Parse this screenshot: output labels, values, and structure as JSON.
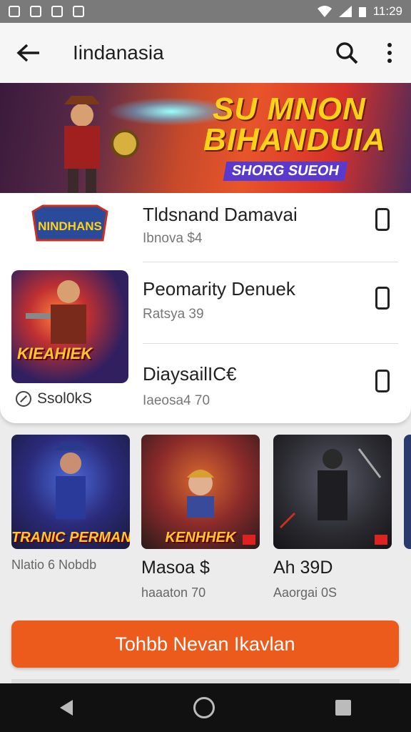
{
  "status_bar": {
    "time": "11:29"
  },
  "app_bar": {
    "title": "Iindanasia"
  },
  "banner": {
    "line1": "SU MNON",
    "line2": "BIHANDUIA",
    "tagline": "SHORG SUEOH"
  },
  "featured_list": [
    {
      "logo_text": "NINDHANS",
      "name": "Tldsnand Damavai",
      "sub": "Ibnova $4"
    },
    {
      "name": "Peomarity Denuek",
      "sub": "Ratsya 39"
    },
    {
      "name": "DiaysailIC€",
      "sub": "Iaeosa4 70"
    }
  ],
  "thumb_caption": "KIEAHIEK",
  "side_label": "Ssol0kS",
  "tiles": [
    {
      "caption": "TRANIC PERMAN",
      "name": "",
      "sub": "Nlatio 6 Nobdb"
    },
    {
      "caption": "KENHHEK",
      "name": "Masoa $",
      "sub": "haaaton 70"
    },
    {
      "caption": "",
      "name": "Ah 39D",
      "sub": "Aaorgai 0S"
    }
  ],
  "cta_label": "Tohbb Nevan Ikavlan",
  "colors": {
    "accent": "#ec5a1c",
    "banner_text": "#ffd21a"
  },
  "icons": [
    "back-arrow-icon",
    "search-icon",
    "more-vert-icon",
    "device-icon",
    "back-nav-icon",
    "home-nav-icon",
    "recents-nav-icon"
  ]
}
